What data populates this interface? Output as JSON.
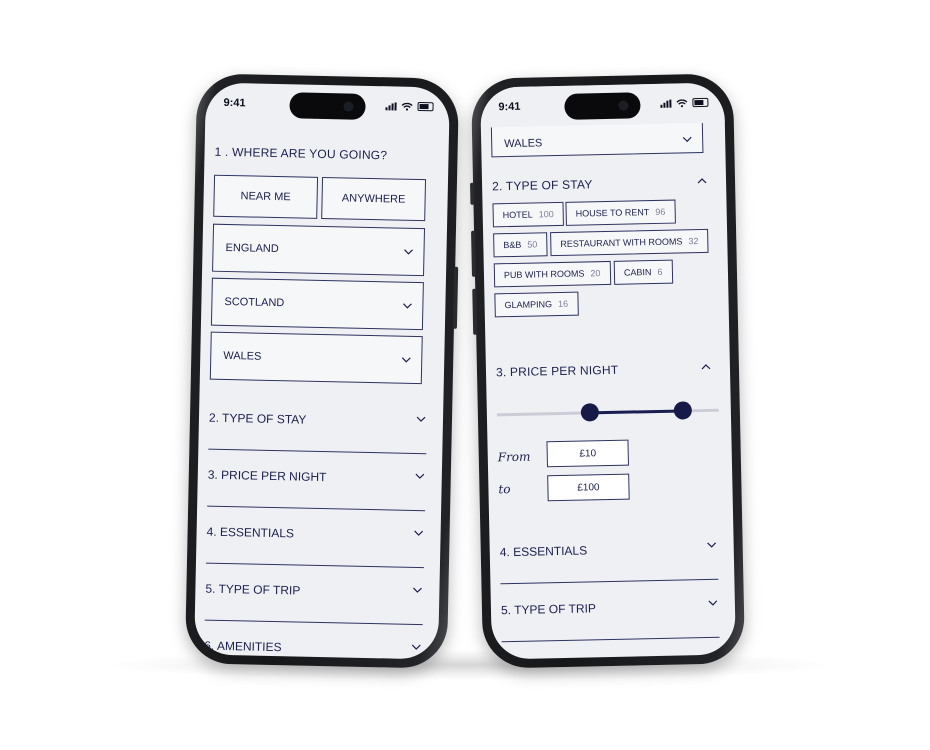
{
  "status": {
    "time": "9:41"
  },
  "left_screen": {
    "question": {
      "number": "1 .",
      "text": "WHERE ARE YOU GOING?"
    },
    "quick_buttons": [
      "NEAR ME",
      "ANYWHERE"
    ],
    "regions": [
      "ENGLAND",
      "SCOTLAND",
      "WALES"
    ],
    "sections": [
      "2. TYPE OF STAY",
      "3. PRICE PER NIGHT",
      "4. ESSENTIALS",
      "5. TYPE OF TRIP",
      "6. AMENITIES"
    ]
  },
  "right_screen": {
    "region_partial": "WALES",
    "type_of_stay": {
      "title": "2. TYPE OF STAY",
      "chips": [
        {
          "label": "HOTEL",
          "count": "100"
        },
        {
          "label": "HOUSE TO RENT",
          "count": "96"
        },
        {
          "label": "B&B",
          "count": "50"
        },
        {
          "label": "RESTAURANT WITH ROOMS",
          "count": "32"
        },
        {
          "label": "PUB WITH ROOMS",
          "count": "20"
        },
        {
          "label": "CABIN",
          "count": "6"
        },
        {
          "label": "GLAMPING",
          "count": "16"
        }
      ]
    },
    "price": {
      "title": "3. PRICE PER NIGHT",
      "slider": {
        "low": 0.42,
        "high": 0.84
      },
      "from_label": "From",
      "to_label": "to",
      "from_value": "£10",
      "to_value": "£100"
    },
    "sections": [
      "4. ESSENTIALS",
      "5. TYPE OF TRIP"
    ]
  },
  "colors": {
    "navy": "#1b1f4e",
    "screen_bg": "#eff0f4",
    "track": "#cbccd8"
  }
}
